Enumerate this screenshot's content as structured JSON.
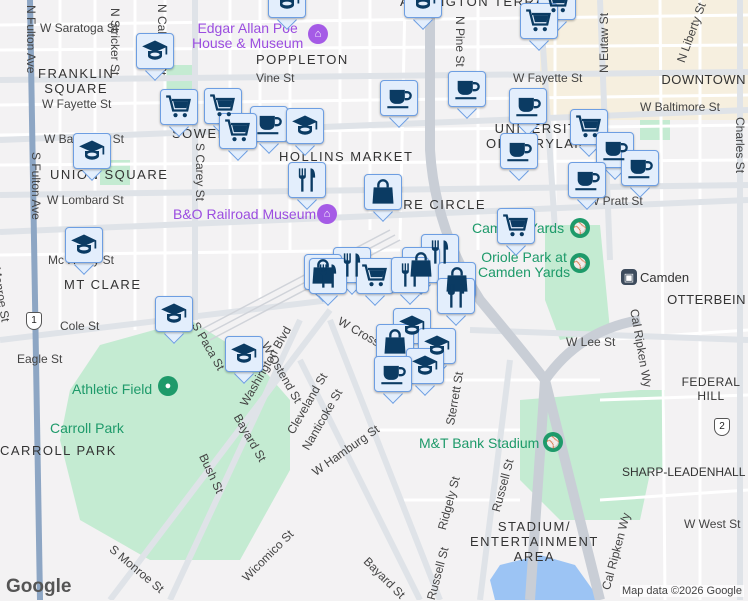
{
  "neighborhoods": [
    "FRANKLIN\nSQUARE",
    "POPPLETON",
    "SOWEBO",
    "HOLLINS MARKET",
    "UNION SQUARE",
    "MT CLARE",
    "BARRE CIRCLE",
    "UNIVERSITY\nOF MARYLAND",
    "OTTERBEIN",
    "CARROLL PARK",
    "SHARP-LEADENHALL",
    "STADIUM/\nENTERTAINMENT\nAREA",
    "ARLINGTON TERRACE",
    "DOWNTOWN",
    "FEDERAL HILL"
  ],
  "pois": {
    "poe": "Edgar Allan Poe\nHouse & Museum",
    "bo": "B&O Railroad Museum",
    "camden_yards": "Camden Yards",
    "oriole": "Oriole Park at\nCamden Yards",
    "athletic": "Athletic Field",
    "carroll": "Carroll Park",
    "mt_bank": "M&T Bank Stadium",
    "camden": "Camden"
  },
  "streets": [
    "W Saratoga St",
    "N Stricker St",
    "N Calhoun St",
    "Vine St",
    "W Fayette St",
    "W Baltimore St",
    "W Lombard St",
    "W Pratt St",
    "Mc Henry St",
    "Cole St",
    "Eagle St",
    "N Fulton Ave",
    "S Fulton Ave",
    "S Carey St",
    "Washington Blvd",
    "W Ostend St",
    "Cleveland St",
    "Nanticoke St",
    "W Hamburg St",
    "Bayard St",
    "Bush St",
    "Wicomico St",
    "S Monroe St",
    "N Pine St",
    "N Eutaw St",
    "N Liberty St",
    "Charles St",
    "W Lee St",
    "Cal Ripken Wy",
    "Russell St",
    "Ridgely St",
    "Sterrett St",
    "W Cross St",
    "W West St",
    "S Monroe St",
    "S Paca St",
    "W Fayette St",
    "W Baltimore St",
    "Washington Blvd"
  ],
  "route_shields": [
    "1",
    "2"
  ],
  "google_logo": "Google",
  "attribution": "Map data ©2026 Google",
  "marker_types": [
    "school",
    "shopping-cart",
    "coffee",
    "restaurant",
    "shopping-bag"
  ],
  "colors": {
    "marker_bg": "#e3eefc",
    "marker_border": "#6d9ee2",
    "marker_icon": "#0b3b63",
    "park": "#bfe8cf",
    "poi_purple": "#9b4de0",
    "poi_green": "#1e9a6a"
  }
}
